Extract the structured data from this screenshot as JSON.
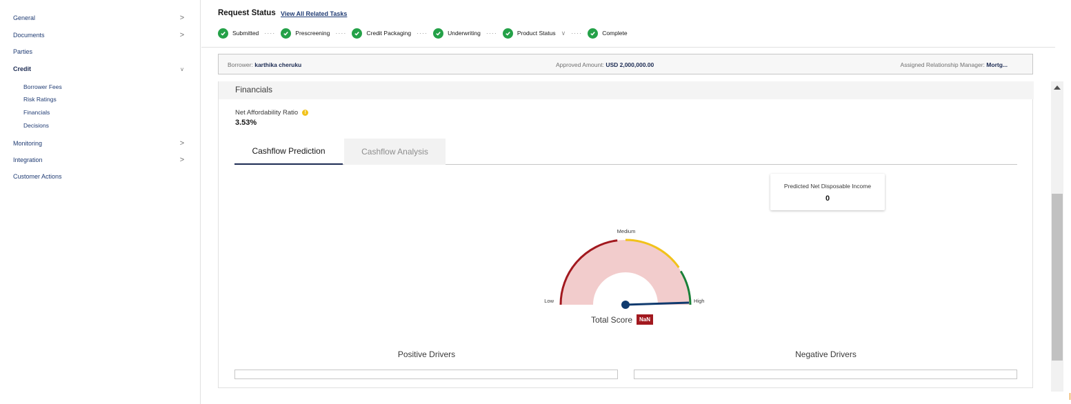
{
  "sidebar": {
    "items": [
      {
        "label": "General",
        "chevron": ">"
      },
      {
        "label": "Documents",
        "chevron": ">"
      },
      {
        "label": "Parties",
        "chevron": ""
      },
      {
        "label": "Credit",
        "chevron": "v"
      },
      {
        "label": "Monitoring",
        "chevron": ">"
      },
      {
        "label": "Integration",
        "chevron": ">"
      },
      {
        "label": "Customer Actions",
        "chevron": ""
      }
    ],
    "credit_subitems": [
      "Borrower Fees",
      "Risk Ratings",
      "Financials",
      "Decisions"
    ]
  },
  "header": {
    "title": "Request Status",
    "link": "View All Related Tasks",
    "steps": [
      "Submitted",
      "Prescreening",
      "Credit Packaging",
      "Underwriting",
      "Product Status",
      "Complete"
    ],
    "step_separator": "····",
    "product_status_chevron": "∨"
  },
  "infobar": {
    "borrower_label": "Borrower:",
    "borrower_value": "karthika cheruku",
    "amount_label": "Approved Amount:",
    "amount_value": "USD 2,000,000.00",
    "manager_label": "Assigned Relationship Manager:",
    "manager_value": "Mortg..."
  },
  "financials": {
    "title": "Financials",
    "nar_label": "Net Affordability Ratio",
    "nar_value": "3.53%",
    "tabs": [
      "Cashflow Prediction",
      "Cashflow Analysis"
    ],
    "pndi_label": "Predicted Net Disposable Income",
    "pndi_value": "0",
    "gauge": {
      "low": "Low",
      "medium": "Medium",
      "high": "High"
    },
    "total_score_label": "Total Score",
    "total_score_value": "NaN",
    "positive_drivers": "Positive Drivers",
    "negative_drivers": "Negative Drivers"
  },
  "colors": {
    "success": "#24a148",
    "gauge_low": "#a2191f",
    "gauge_medium": "#f1c21b",
    "gauge_high": "#198038",
    "gauge_fill": "#f2cccc",
    "needle": "#0f3a6e",
    "badge": "#a2191f"
  }
}
